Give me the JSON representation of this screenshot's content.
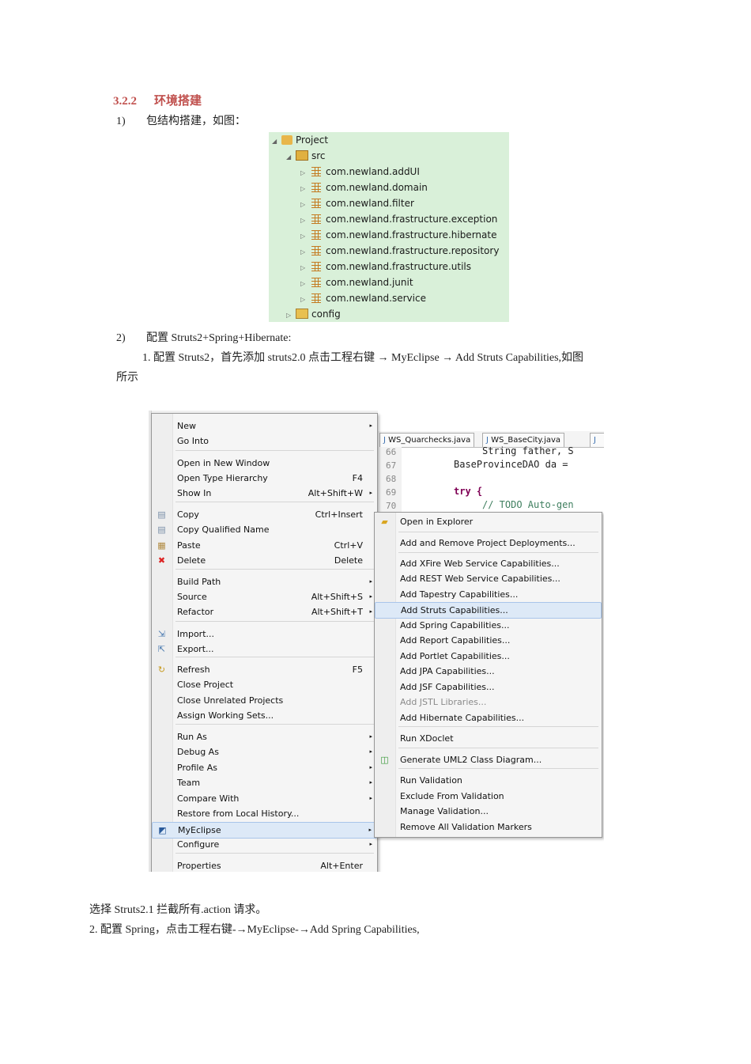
{
  "section": {
    "number": "3.2.2",
    "title": "环境搭建"
  },
  "step1": {
    "num": "1)",
    "text": "包结构搭建，如图："
  },
  "tree": {
    "project": "Project",
    "src": "src",
    "packages": [
      "com.newland.addUI",
      "com.newland.domain",
      "com.newland.filter",
      "com.newland.frastructure.exception",
      "com.newland.frastructure.hibernate",
      "com.newland.frastructure.repository",
      "com.newland.frastructure.utils",
      "com.newland.junit",
      "com.newland.service"
    ],
    "config": "config"
  },
  "step2": {
    "num": "2)",
    "text": "配置 Struts2+Spring+Hibernate:"
  },
  "step2_1": {
    "line1": "1.  配置 Struts2，首先添加 struts2.0    点击工程右键  → MyEclipse → Add Struts Capabilities,如图",
    "line2": "所示"
  },
  "editor": {
    "tabs": [
      "WS_Quarchecks.java",
      "WS_BaseCity.java"
    ],
    "lines": [
      {
        "num": "66",
        "code": "String father, S"
      },
      {
        "num": "67",
        "code": "BaseProvinceDAO da ="
      },
      {
        "num": "68",
        "code": ""
      },
      {
        "num": "69",
        "code": "try {"
      },
      {
        "num": "70",
        "code": "// TODO Auto-gen"
      }
    ]
  },
  "context_menu": {
    "items": [
      {
        "label": "New",
        "shortcut": "",
        "arrow": "▸"
      },
      {
        "label": "Go Into",
        "shortcut": ""
      },
      {
        "label": "Open in New Window",
        "shortcut": ""
      },
      {
        "label": "Open Type Hierarchy",
        "shortcut": "F4"
      },
      {
        "label": "Show In",
        "shortcut": "Alt+Shift+W",
        "arrow": "▸"
      },
      {
        "label": "Copy",
        "shortcut": "Ctrl+Insert"
      },
      {
        "label": "Copy Qualified Name",
        "shortcut": ""
      },
      {
        "label": "Paste",
        "shortcut": "Ctrl+V"
      },
      {
        "label": "Delete",
        "shortcut": "Delete"
      },
      {
        "label": "Build Path",
        "shortcut": "",
        "arrow": "▸"
      },
      {
        "label": "Source",
        "shortcut": "Alt+Shift+S",
        "arrow": "▸"
      },
      {
        "label": "Refactor",
        "shortcut": "Alt+Shift+T",
        "arrow": "▸"
      },
      {
        "label": "Import...",
        "shortcut": ""
      },
      {
        "label": "Export...",
        "shortcut": ""
      },
      {
        "label": "Refresh",
        "shortcut": "F5"
      },
      {
        "label": "Close Project",
        "shortcut": ""
      },
      {
        "label": "Close Unrelated Projects",
        "shortcut": ""
      },
      {
        "label": "Assign Working Sets...",
        "shortcut": ""
      },
      {
        "label": "Run As",
        "shortcut": "",
        "arrow": "▸"
      },
      {
        "label": "Debug As",
        "shortcut": "",
        "arrow": "▸"
      },
      {
        "label": "Profile As",
        "shortcut": "",
        "arrow": "▸"
      },
      {
        "label": "Team",
        "shortcut": "",
        "arrow": "▸"
      },
      {
        "label": "Compare With",
        "shortcut": "",
        "arrow": "▸"
      },
      {
        "label": "Restore from Local History...",
        "shortcut": ""
      },
      {
        "label": "MyEclipse",
        "shortcut": "",
        "arrow": "▸"
      },
      {
        "label": "Configure",
        "shortcut": "",
        "arrow": "▸"
      },
      {
        "label": "Properties",
        "shortcut": "Alt+Enter"
      }
    ]
  },
  "submenu": {
    "items": [
      "Open in Explorer",
      "Add and Remove Project Deployments...",
      "Add XFire Web Service Capabilities...",
      "Add REST Web Service Capabilities...",
      "Add Tapestry Capabilities...",
      "Add Struts Capabilities...",
      "Add Spring Capabilities...",
      "Add Report Capabilities...",
      "Add Portlet Capabilities...",
      "Add JPA Capabilities...",
      "Add JSF Capabilities...",
      "Add JSTL Libraries...",
      "Add Hibernate Capabilities...",
      "Run XDoclet",
      "Generate UML2 Class Diagram...",
      "Run Validation",
      "Exclude From Validation",
      "Manage Validation...",
      "Remove All Validation Markers"
    ]
  },
  "after": {
    "line1": "选择 Struts2.1 拦截所有.action 请求。",
    "line2": "2.  配置 Spring，点击工程右键-→MyEclipse-→Add Spring Capabilities,"
  },
  "colors": {
    "heading": "#c0504d",
    "tree_bg": "#d9f0d9",
    "highlight": "#dde9f7"
  }
}
